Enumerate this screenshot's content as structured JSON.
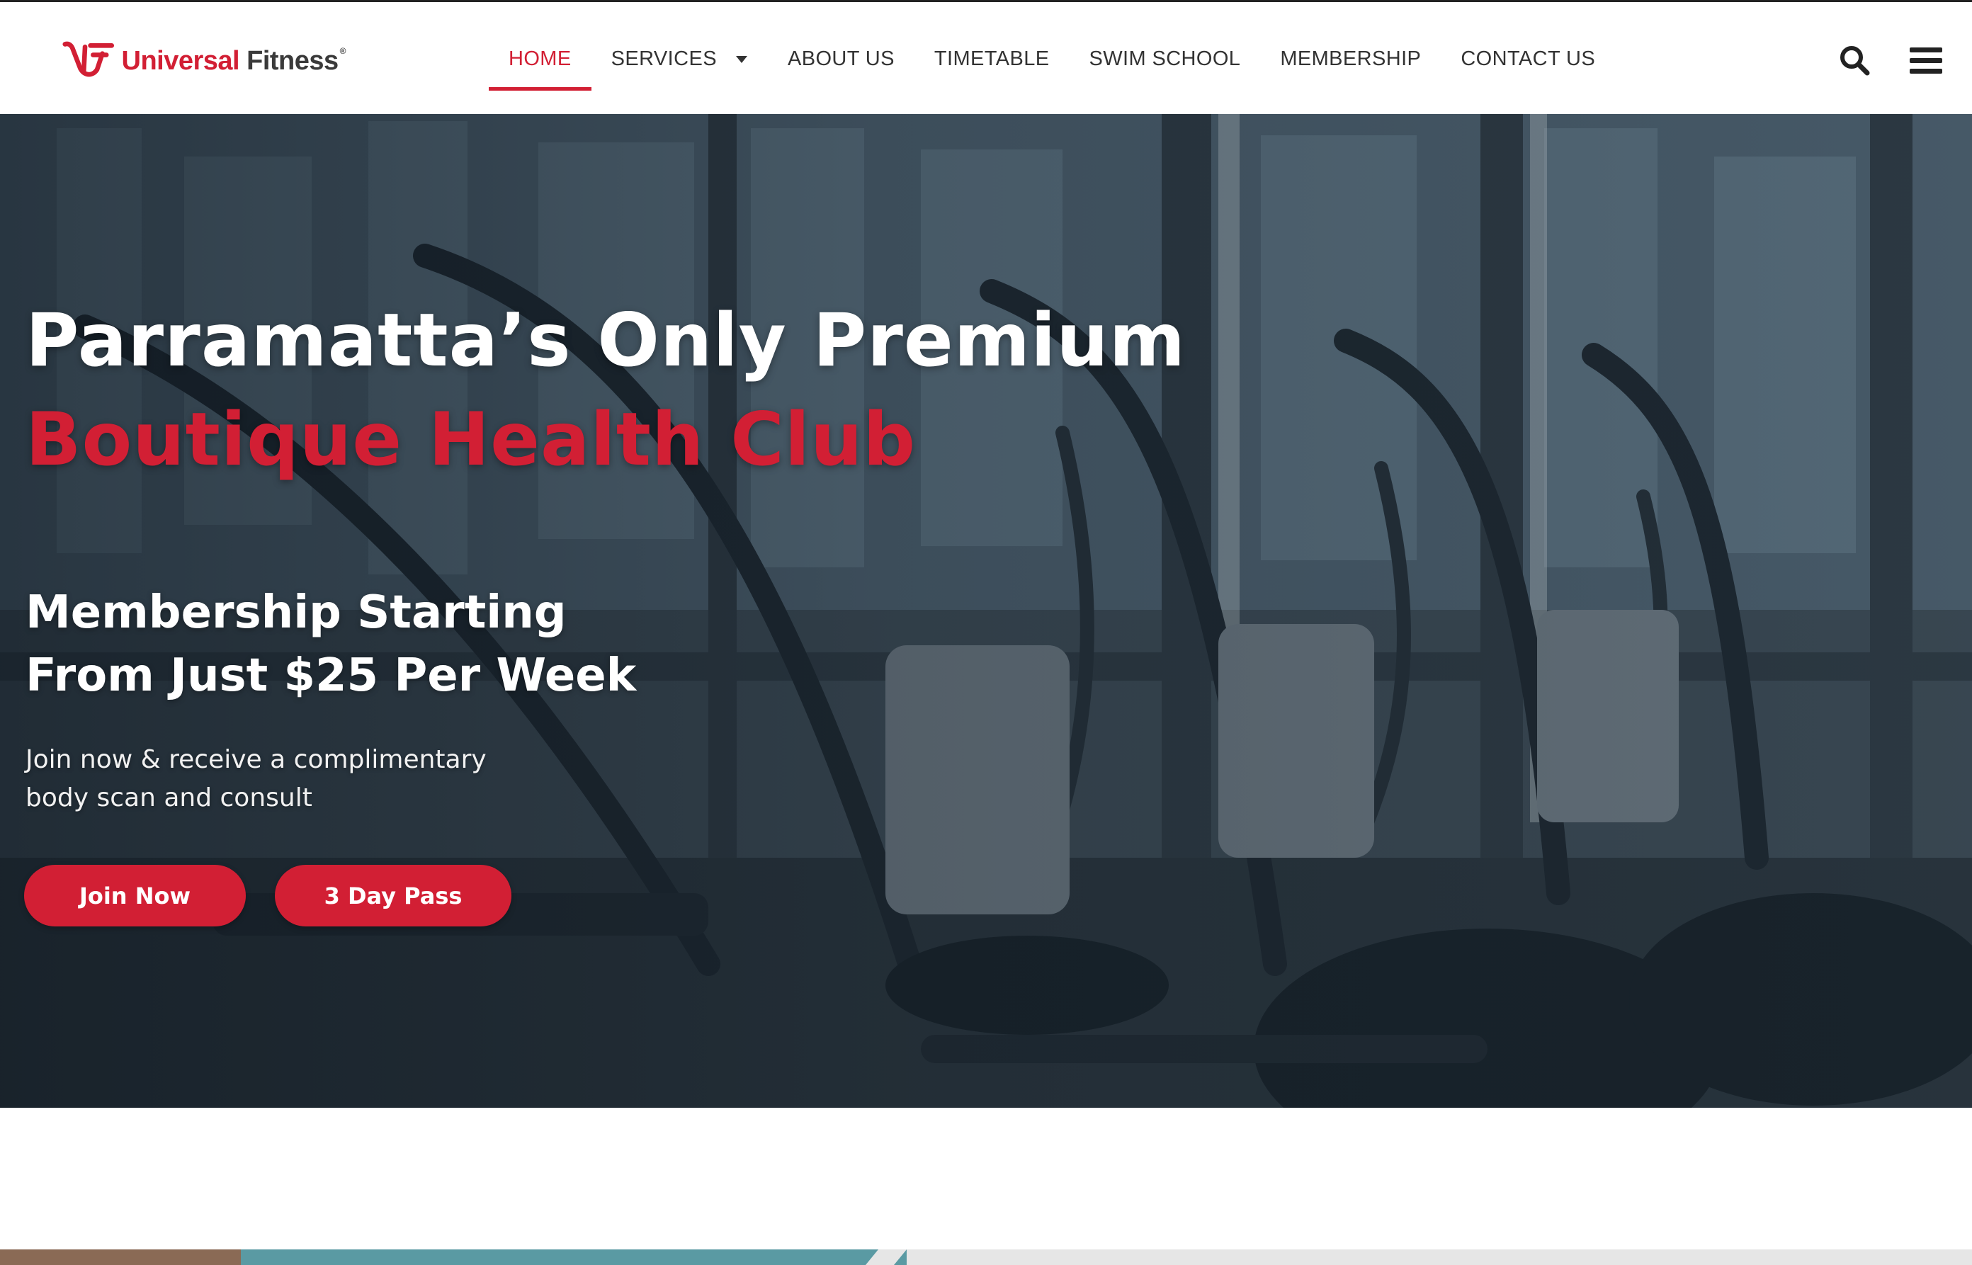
{
  "brand": {
    "name_part1": "Universal",
    "name_part2": "Fitness",
    "registered_mark": "®",
    "primary_color": "#d21f34",
    "dark_color": "#3a3a3a"
  },
  "nav": {
    "items": [
      {
        "label": "HOME",
        "active": true
      },
      {
        "label": "SERVICES",
        "has_dropdown": true
      },
      {
        "label": "ABOUT US"
      },
      {
        "label": "TIMETABLE"
      },
      {
        "label": "SWIM SCHOOL"
      },
      {
        "label": "MEMBERSHIP"
      },
      {
        "label": "CONTACT US"
      }
    ],
    "icons": [
      "search-icon",
      "hamburger-menu-icon",
      "caret-down-icon"
    ]
  },
  "hero": {
    "title_line1": "Parramatta’s Only Premium",
    "title_line2": "Boutique Health Club",
    "subtitle_line1": "Membership Starting",
    "subtitle_line2": "From Just $25 Per Week",
    "text_line1": "Join now & receive a complimentary",
    "text_line2": "body scan and consult",
    "buttons": {
      "join": "Join Now",
      "pass": "3 Day Pass"
    }
  }
}
